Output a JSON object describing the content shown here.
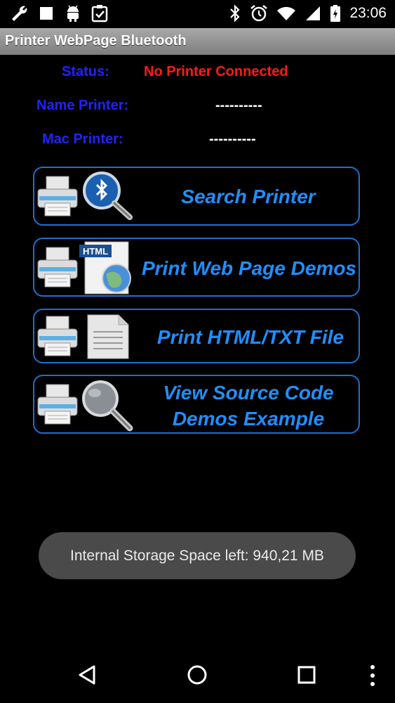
{
  "statusbar": {
    "time": "23:06"
  },
  "app": {
    "title": "Printer WebPage Bluetooth"
  },
  "info": {
    "status_label": "Status:",
    "status_value": "No Printer Connected",
    "name_label": "Name Printer:",
    "name_value": "----------",
    "mac_label": "Mac Printer:",
    "mac_value": "----------"
  },
  "buttons": {
    "search": "Search Printer",
    "web_demos": "Print Web Page Demos",
    "html_file": "Print HTML/TXT File",
    "source_line1": "View Source Code",
    "source_line2": "Demos Example",
    "html_badge": "HTML"
  },
  "toast": {
    "text": "Internal Storage Space left: 940,21 MB"
  },
  "colors": {
    "accent": "#1f8fff",
    "status_red": "#ff1a1a",
    "label_blue": "#2222ff"
  }
}
